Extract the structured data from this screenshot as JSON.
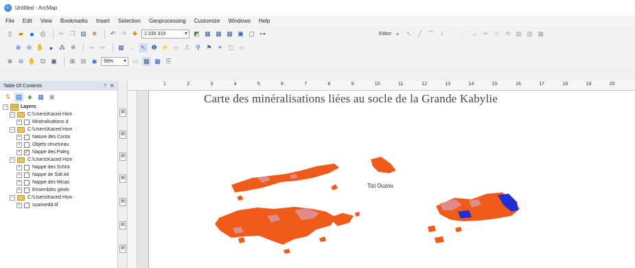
{
  "window": {
    "title": "Untitled - ArcMap"
  },
  "menu": [
    "File",
    "Edit",
    "View",
    "Bookmarks",
    "Insert",
    "Selection",
    "Geoprocessing",
    "Customize",
    "Windows",
    "Help"
  ],
  "toolbar": {
    "scale_value": "1:330 319",
    "zoom_value": "99%",
    "editor_label": "Editor"
  },
  "toc": {
    "title": "Table Of Contents",
    "close_glyph": "✕",
    "pin_glyph": "ᛘ",
    "root_label": "Layers",
    "items": [
      {
        "label": "C:\\Users\\Kaced Hsm",
        "kind": "group"
      },
      {
        "label": "Minéralisations d",
        "kind": "layer",
        "checked": false
      },
      {
        "label": "C:\\Users\\Kaced Hsm",
        "kind": "group"
      },
      {
        "label": "Nature des Conta",
        "kind": "layer",
        "checked": false
      },
      {
        "label": "Objets structurau",
        "kind": "layer",
        "checked": false
      },
      {
        "label": "Nappe des Paleg",
        "kind": "layer",
        "checked": true
      },
      {
        "label": "C:\\Users\\Kaced Hsm",
        "kind": "group"
      },
      {
        "label": "Nappe des Schist",
        "kind": "layer",
        "checked": false
      },
      {
        "label": "Nappe de Sidi Ali",
        "kind": "layer",
        "checked": false
      },
      {
        "label": "Nappe des Micas",
        "kind": "layer",
        "checked": false
      },
      {
        "label": "Ensembles géolo",
        "kind": "layer",
        "checked": false
      },
      {
        "label": "C:\\Users\\Kaced Hsm",
        "kind": "group"
      },
      {
        "label": "scannedd.tif",
        "kind": "layer",
        "checked": false
      }
    ]
  },
  "ruler": {
    "ticks": [
      "1",
      "2",
      "3",
      "4",
      "5",
      "6",
      "7",
      "8",
      "9",
      "10",
      "11",
      "12",
      "13",
      "14",
      "15",
      "16",
      "17",
      "18",
      "19",
      "20"
    ]
  },
  "map": {
    "title": "Carte des minéralisations liées au socle de la Grande Kabylie",
    "city_label": "Tizi Ouzou",
    "colors": {
      "orange": "#f05a1a",
      "pink": "#e08a8a",
      "blue": "#1e2fd8"
    }
  }
}
